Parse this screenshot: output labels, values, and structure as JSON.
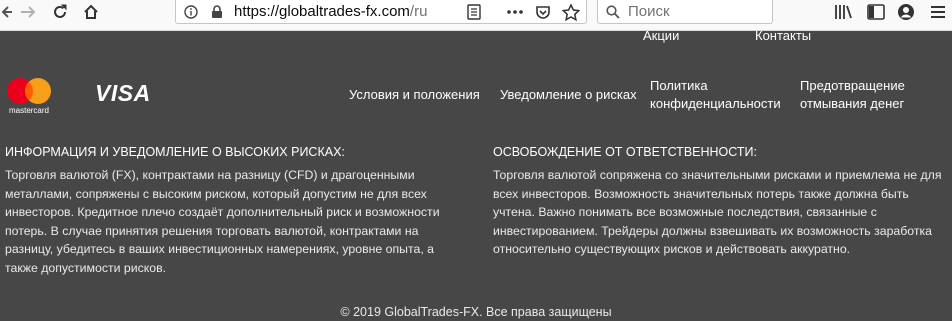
{
  "browser": {
    "url_host": "https://globaltrades-fx.com",
    "url_path": "/ru",
    "search_placeholder": "Поиск",
    "icons": [
      "back-icon",
      "forward-icon",
      "reload-icon",
      "home-icon",
      "info-icon",
      "lock-icon",
      "reader-icon",
      "more-icon",
      "pocket-icon",
      "bookmark-star-icon",
      "search-icon",
      "library-icon",
      "sidebar-icon",
      "account-icon",
      "menu-icon"
    ]
  },
  "nav_top": {
    "promotions": "Акции",
    "contacts": "Контакты"
  },
  "payment": {
    "mastercard_label": "mastercard",
    "visa_label": "VISA",
    "mastercard_colors": [
      "#eb001b",
      "#f79e1b",
      "#ff5f00"
    ]
  },
  "nav_links": {
    "terms": "Условия и положения",
    "risk_notice": "Уведомление о рисках",
    "privacy_line1": "Политика",
    "privacy_line2": "конфиденциальности",
    "aml_line1": "Предотвращение",
    "aml_line2": "отмывания денег"
  },
  "risk_section": {
    "title": "ИНФОРМАЦИЯ И УВЕДОМЛЕНИЕ О ВЫСОКИХ РИСКАХ:",
    "lines": [
      "Торговля валютой (FX), контрактами на разницу (CFD) и драгоценными",
      "металлами, сопряжены с высоким риском, который допустим не для всех",
      "инвесторов. Кредитное плечо создаёт дополнительный риск и возможности",
      "потерь. В случае принятия решения торговать валютой, контрактами на",
      "разницу, убедитесь в ваших инвестиционных намерениях, уровне опыта, а",
      "также допустимости рисков."
    ]
  },
  "disclaimer_section": {
    "title": "ОСВОБОЖДЕНИЕ ОТ ОТВЕТСТВЕННОСТИ:",
    "lines": [
      "Торговля валютой сопряжена со значительными рисками и приемлема не для",
      "всех инвесторов. Возможность значительных потерь также должна быть",
      "учтена. Важно понимать все возможные последствия, связанные с",
      "инвестированием. Трейдеры должны взвешивать их возможность заработка",
      "относительно существующих рисков и действовать аккуратно."
    ]
  },
  "footer": {
    "copyright": "© 2019 GlobalTrades-FX. Все права защищены"
  }
}
